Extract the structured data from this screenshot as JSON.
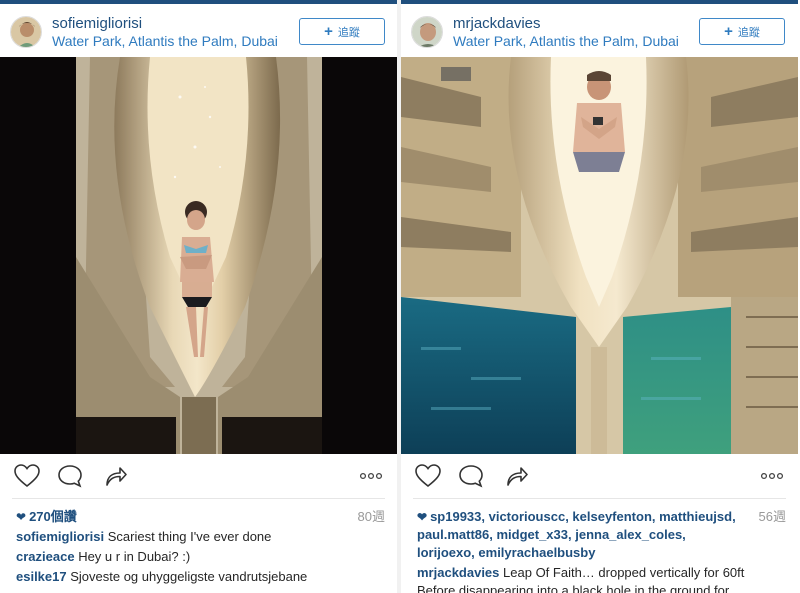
{
  "posts": [
    {
      "username": "sofiemigliorisi",
      "location": "Water Park, Atlantis the Palm, Dubai",
      "follow_label": "追蹤",
      "likes": "270個讚",
      "time_ago": "80週",
      "comments": [
        {
          "user": "sofiemigliorisi",
          "text": "Scariest thing I've ever done"
        },
        {
          "user": "crazieace",
          "text": "Hey u r in Dubai? :)"
        },
        {
          "user": "esilke17",
          "text": "Sjoveste og uhyggeligste vandrutsjebane"
        }
      ]
    },
    {
      "username": "mrjackdavies",
      "location": "Water Park, Atlantis the Palm, Dubai",
      "follow_label": "追蹤",
      "likers": "sp19933, victoriouscc, kelseyfenton, matthieujsd, paul.matt86, midget_x33, jenna_alex_coles, lorijoexo, emilyrachaelbusby",
      "time_ago": "56週",
      "caption_user": "mrjackdavies",
      "caption_text": "Leap Of Faith… dropped vertically for 60ft Before disappearing into a black hole in the ground for"
    }
  ],
  "colors": {
    "accent": "#1f4f7e",
    "link": "#2f7bbf",
    "muted": "#999999"
  },
  "icons": [
    "heart-icon",
    "comment-bubble-icon",
    "share-arrow-icon",
    "more-options-icon",
    "plus-icon"
  ]
}
